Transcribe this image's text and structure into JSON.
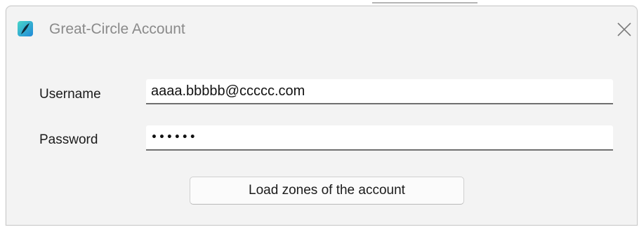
{
  "window": {
    "title": "Great-Circle Account",
    "app_icon": "feather-app-icon",
    "close_icon": "close-icon"
  },
  "form": {
    "username_label": "Username",
    "username_value": "aaaa.bbbbb@ccccc.com",
    "password_label": "Password",
    "password_value": "••••••"
  },
  "actions": {
    "load_label": "Load zones of the account"
  },
  "colors": {
    "icon_gradient_start": "#49d6c8",
    "icon_gradient_end": "#1f88d8",
    "window_bg": "#f3f3f3"
  }
}
